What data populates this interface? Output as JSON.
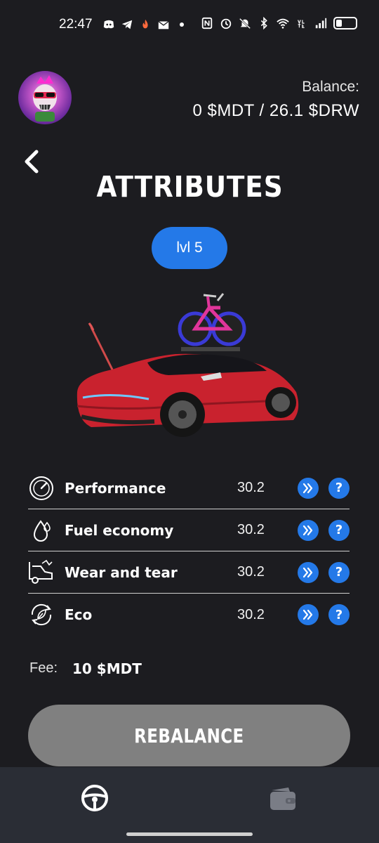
{
  "status_bar": {
    "time": "22:47"
  },
  "header": {
    "balance_label": "Balance:",
    "balance_value": "0 $MDT / 26.1 $DRW"
  },
  "page": {
    "title": "ATTRIBUTES",
    "level": "lvl 5"
  },
  "attributes": [
    {
      "name": "Performance",
      "value": "30.2",
      "icon": "speedometer-icon"
    },
    {
      "name": "Fuel economy",
      "value": "30.2",
      "icon": "fuel-drop-icon"
    },
    {
      "name": "Wear and tear",
      "value": "30.2",
      "icon": "car-damage-icon"
    },
    {
      "name": "Eco",
      "value": "30.2",
      "icon": "eco-leaf-icon"
    }
  ],
  "fee": {
    "label": "Fee:",
    "value": "10 $MDT"
  },
  "actions": {
    "rebalance_label": "REBALANCE"
  },
  "colors": {
    "accent": "#2479e8",
    "background": "#1c1c20",
    "button_disabled": "#808080",
    "nav_bg": "#2a2d35"
  },
  "nav": [
    {
      "icon": "steering-wheel-icon"
    },
    {
      "icon": "wallet-icon"
    }
  ]
}
